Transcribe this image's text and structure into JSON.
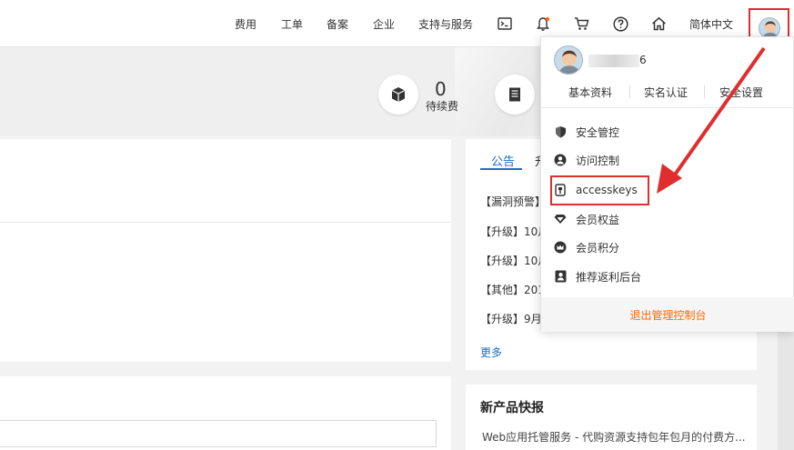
{
  "nav": {
    "items": [
      "费用",
      "工单",
      "备案",
      "企业",
      "支持与服务"
    ],
    "icons": [
      "terminal-icon",
      "bell-icon",
      "cart-icon",
      "help-icon",
      "home-icon"
    ],
    "language": "简体中文",
    "bell_dot_color": "#ff6a00"
  },
  "stats": {
    "renew_count": "0",
    "renew_label": "待续费"
  },
  "notice": {
    "tabs": [
      "公告",
      "升"
    ],
    "items": [
      "【漏洞预警】",
      "【升级】10月",
      "【升级】10月",
      "【其他】201",
      "【升级】9月"
    ],
    "more": "更多"
  },
  "new_products": {
    "title": "新产品快报",
    "item": "Web应用托管服务 - 代购资源支持包年包月的付费方..."
  },
  "dropdown": {
    "name_suffix": "6",
    "sub_links": [
      "基本资料",
      "实名认证",
      "安全设置"
    ],
    "items": [
      {
        "label": "安全管控",
        "icon": "shield-icon"
      },
      {
        "label": "访问控制",
        "icon": "user-circle-icon"
      },
      {
        "label": "accesskeys",
        "icon": "key-icon"
      },
      {
        "label": "会员权益",
        "icon": "diamond-icon"
      },
      {
        "label": "会员积分",
        "icon": "crown-icon"
      },
      {
        "label": "推荐返利后台",
        "icon": "portrait-icon"
      }
    ],
    "logout": "退出管理控制台"
  },
  "colors": {
    "accent_blue": "#1a6fc3",
    "accent_orange": "#ff6a00",
    "annotation_red": "#e02d2d"
  }
}
